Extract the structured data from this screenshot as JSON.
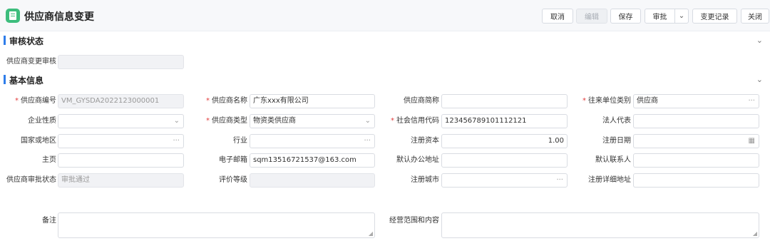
{
  "header": {
    "title": "供应商信息变更",
    "buttons": {
      "cancel": "取消",
      "edit": "编辑",
      "save": "保存",
      "approve": "审批",
      "approve_dropdown": "⌄",
      "change_log": "变更记录",
      "close": "关闭"
    }
  },
  "sections": {
    "audit": {
      "title": "审核状态",
      "chevron": "⌄"
    },
    "basic": {
      "title": "基本信息",
      "chevron": "⌄"
    }
  },
  "audit": {
    "change_audit": {
      "label": "供应商变更审核",
      "value": ""
    }
  },
  "form": {
    "supplier_code": {
      "label": "供应商编号",
      "value": "VM_GYSDA2022123000001",
      "required": true
    },
    "supplier_name": {
      "label": "供应商名称",
      "value": "广东xxx有限公司",
      "required": true
    },
    "supplier_short": {
      "label": "供应商简称",
      "value": ""
    },
    "partner_type": {
      "label": "往来单位类别",
      "value": "供应商",
      "required": true,
      "suffix": "···"
    },
    "enterprise_nature": {
      "label": "企业性质",
      "value": "",
      "suffix": "⌄"
    },
    "supplier_type": {
      "label": "供应商类型",
      "value": "物资类供应商",
      "required": true,
      "suffix": "⌄"
    },
    "credit_code": {
      "label": "社会信用代码",
      "value": "123456789101112121",
      "required": true
    },
    "legal_rep": {
      "label": "法人代表",
      "value": ""
    },
    "country": {
      "label": "国家或地区",
      "value": "",
      "suffix": "···"
    },
    "industry": {
      "label": "行业",
      "value": "",
      "suffix": "···"
    },
    "reg_capital": {
      "label": "注册资本",
      "value": "1.00"
    },
    "reg_date": {
      "label": "注册日期",
      "value": "",
      "suffix": "▦"
    },
    "homepage": {
      "label": "主页",
      "value": ""
    },
    "email": {
      "label": "电子邮箱",
      "value": "sqm13516721537@163.com"
    },
    "office_address": {
      "label": "默认办公地址",
      "value": ""
    },
    "contact": {
      "label": "默认联系人",
      "value": ""
    },
    "approval_status": {
      "label": "供应商审批状态",
      "value": "审批通过"
    },
    "rating": {
      "label": "评价等级",
      "value": ""
    },
    "reg_city": {
      "label": "注册城市",
      "value": "",
      "suffix": "···"
    },
    "reg_address": {
      "label": "注册详细地址",
      "value": ""
    },
    "remarks": {
      "label": "备注",
      "value": ""
    },
    "business_scope": {
      "label": "经营范围和内容",
      "value": ""
    }
  },
  "colors": {
    "accent": "#2f7dea",
    "required": "#e23b3b",
    "icon": "#3dbd7d"
  }
}
